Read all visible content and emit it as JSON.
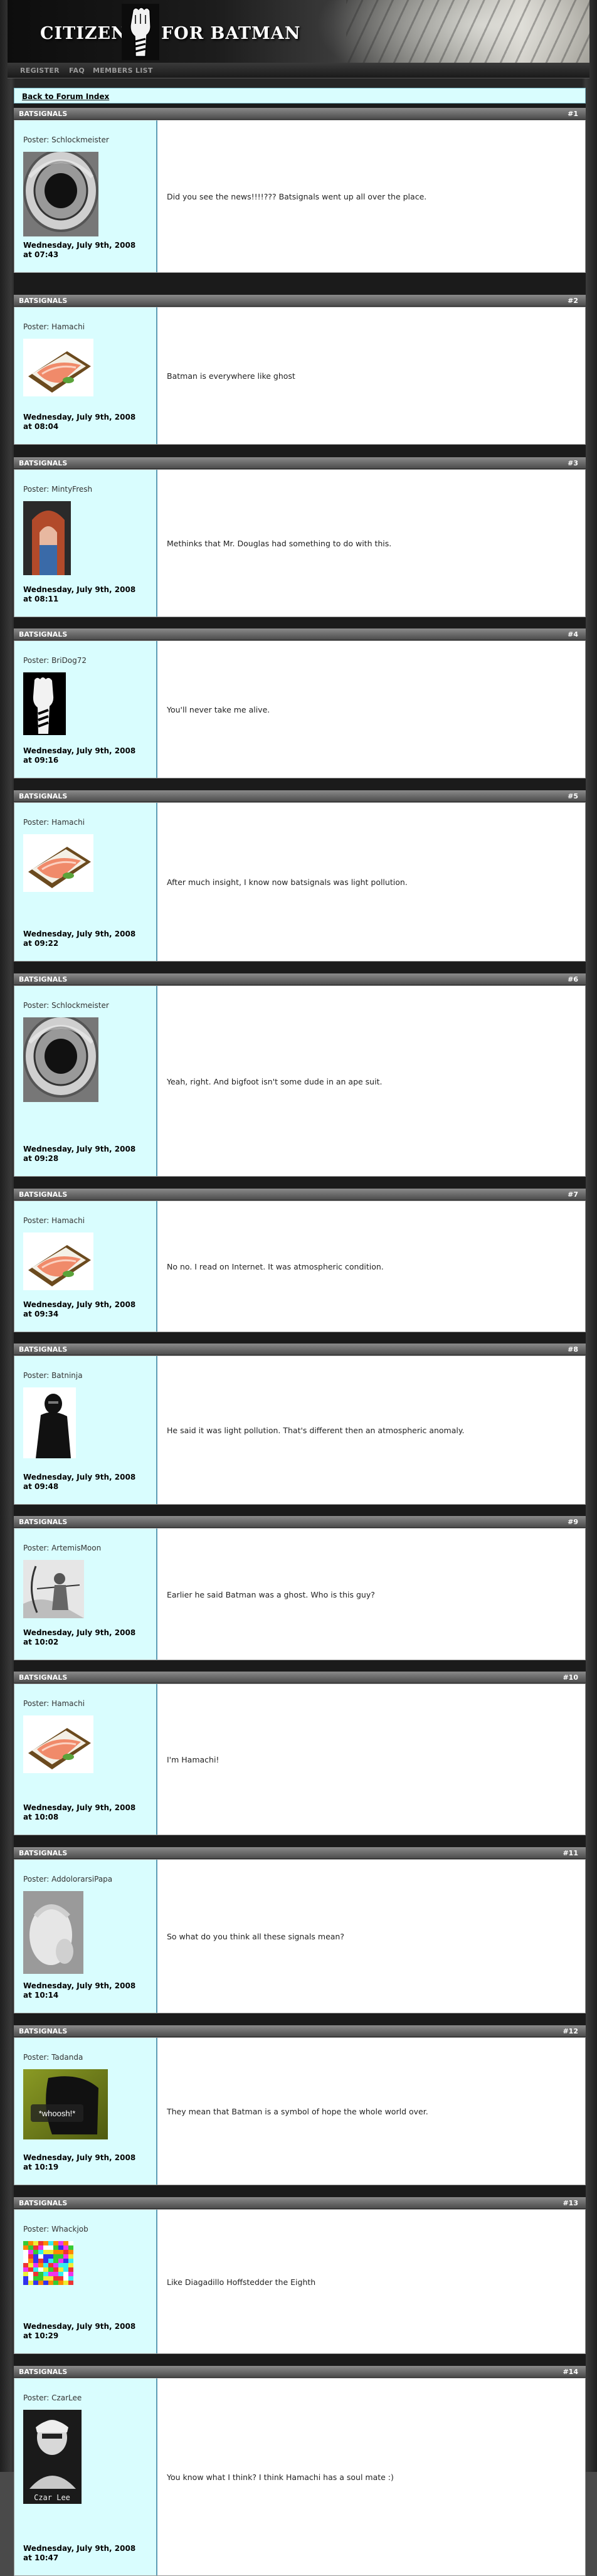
{
  "site": {
    "logo_left": "CITIZENS",
    "logo_right": "FOR BATMAN"
  },
  "nav": {
    "items": [
      {
        "label": "REGISTER"
      },
      {
        "label": "FAQ"
      },
      {
        "label": "MEMBERS LIST"
      }
    ]
  },
  "thread": {
    "back_link": "Back to Forum Index",
    "posts": [
      {
        "subject": "BATSIGNALS",
        "number": "#1",
        "poster": "Poster: Schlockmeister",
        "date_line1": "Wednesday, July 9th, 2008",
        "date_line2": "at 07:43",
        "message": "Did you see the news!!!!??? Batsignals went up all over the place.",
        "avatar": "tire-closeup-avatar"
      },
      {
        "subject": "BATSIGNALS",
        "number": "#2",
        "poster": "Poster: Hamachi",
        "date_line1": "Wednesday, July 9th, 2008",
        "date_line2": "at 08:04",
        "message": "Batman is everywhere like ghost",
        "avatar": "sushi-avatar"
      },
      {
        "subject": "BATSIGNALS",
        "number": "#3",
        "poster": "Poster: MintyFresh",
        "date_line1": "Wednesday, July 9th, 2008",
        "date_line2": "at 08:11",
        "message": "Methinks that Mr. Douglas had something to do with this.",
        "avatar": "portrait-avatar"
      },
      {
        "subject": "BATSIGNALS",
        "number": "#4",
        "poster": "Poster: BriDog72",
        "date_line1": "Wednesday, July 9th, 2008",
        "date_line2": "at 09:16",
        "message": "You'll never take me alive.",
        "avatar": "raised-fist-avatar"
      },
      {
        "subject": "BATSIGNALS",
        "number": "#5",
        "poster": "Poster: Hamachi",
        "date_line1": "Wednesday, July 9th, 2008",
        "date_line2": "at 09:22",
        "message": "After much insight, I know now batsignals was light pollution.",
        "avatar": "sushi-avatar"
      },
      {
        "subject": "BATSIGNALS",
        "number": "#6",
        "poster": "Poster: Schlockmeister",
        "date_line1": "Wednesday, July 9th, 2008",
        "date_line2": "at 09:28",
        "message": "Yeah, right. And bigfoot isn't some dude in an ape suit.",
        "avatar": "tire-closeup-avatar"
      },
      {
        "subject": "BATSIGNALS",
        "number": "#7",
        "poster": "Poster: Hamachi",
        "date_line1": "Wednesday, July 9th, 2008",
        "date_line2": "at 09:34",
        "message": "No no. I read on Internet. It was atmospheric condition.",
        "avatar": "sushi-avatar"
      },
      {
        "subject": "BATSIGNALS",
        "number": "#8",
        "poster": "Poster: Batninja",
        "date_line1": "Wednesday, July 9th, 2008",
        "date_line2": "at 09:48",
        "message": "He said it was light pollution. That's different then an atmospheric anomaly.",
        "avatar": "ninja-avatar"
      },
      {
        "subject": "BATSIGNALS",
        "number": "#9",
        "poster": "Poster: ArtemisMoon",
        "date_line1": "Wednesday, July 9th, 2008",
        "date_line2": "at 10:02",
        "message": "Earlier he said Batman was a ghost. Who is this guy?",
        "avatar": "archer-avatar"
      },
      {
        "subject": "BATSIGNALS",
        "number": "#10",
        "poster": "Poster: Hamachi",
        "date_line1": "Wednesday, July 9th, 2008",
        "date_line2": "at 10:08",
        "message": "I'm Hamachi!",
        "avatar": "sushi-avatar"
      },
      {
        "subject": "BATSIGNALS",
        "number": "#11",
        "poster": "Poster: AddolorarsiPapa",
        "date_line1": "Wednesday, July 9th, 2008",
        "date_line2": "at 10:14",
        "message": "So what do you think all these signals mean?",
        "avatar": "baby-avatar"
      },
      {
        "subject": "BATSIGNALS",
        "number": "#12",
        "poster": "Poster: Tadanda",
        "date_line1": "Wednesday, July 9th, 2008",
        "date_line2": "at 10:19",
        "message": "They mean that Batman is a symbol of hope the whole world over.",
        "avatar": "whoosh-avatar",
        "avatar_caption": "*whoosh!*"
      },
      {
        "subject": "BATSIGNALS",
        "number": "#13",
        "poster": "Poster: Whackjob",
        "date_line1": "Wednesday, July 9th, 2008",
        "date_line2": "at 10:29",
        "message": "Like Diagadillo Hoffstedder the Eighth",
        "avatar": "colorful-noise-avatar"
      },
      {
        "subject": "BATSIGNALS",
        "number": "#14",
        "poster": "Poster: CzarLee",
        "date_line1": "Wednesday, July 9th, 2008",
        "date_line2": "at 10:47",
        "message": "You know what I think? I think Hamachi has a soul mate :)",
        "avatar": "czar-lee-avatar",
        "avatar_caption": "Czar Lee"
      }
    ]
  },
  "colors": {
    "sidebar_bg": "#d9fdfe",
    "sidebar_border": "#5d9cb5",
    "header_bg": "#6b6b6b",
    "page_bg": "#262626"
  }
}
